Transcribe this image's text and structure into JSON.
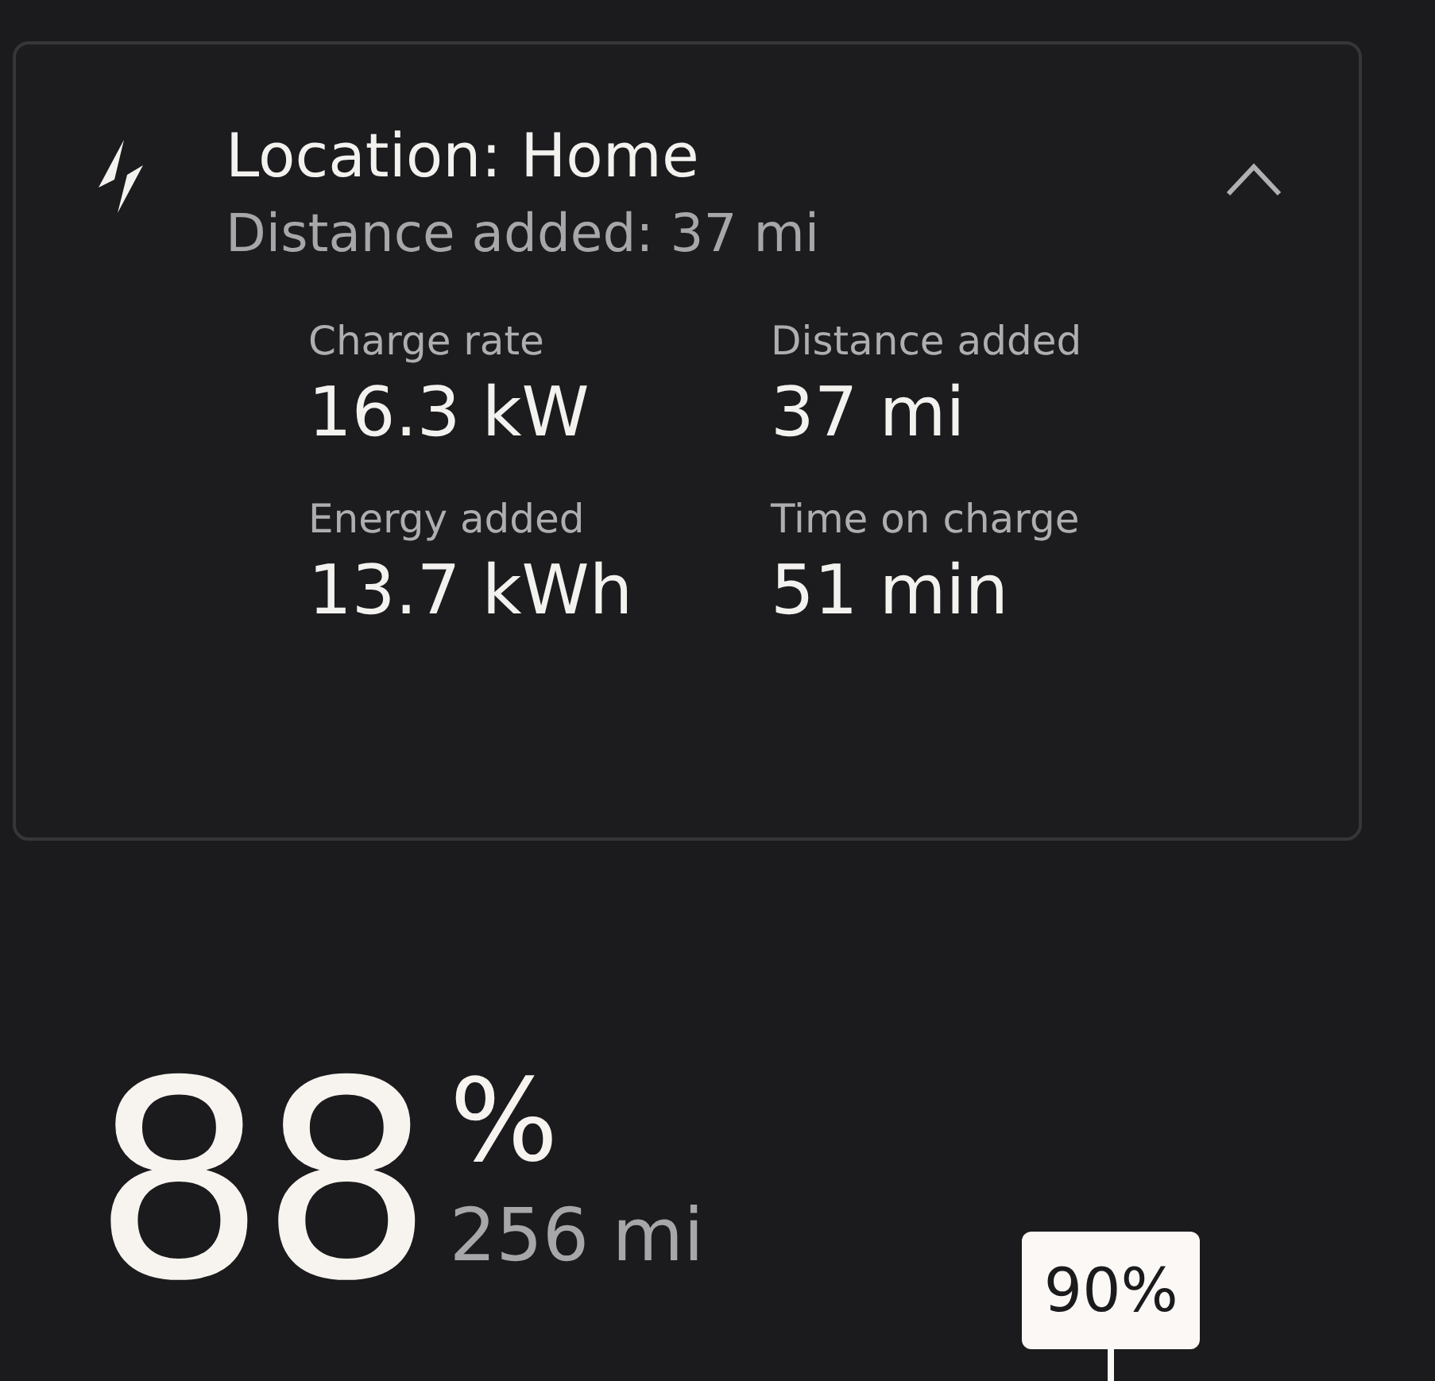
{
  "charge_session": {
    "title": "Location: Home",
    "subtitle": "Distance added: 37 mi",
    "expanded": true,
    "stats": [
      {
        "label": "Charge rate",
        "value": "16.3 kW"
      },
      {
        "label": "Distance added",
        "value": "37 mi"
      },
      {
        "label": "Energy added",
        "value": "13.7 kWh"
      },
      {
        "label": "Time on charge",
        "value": "51 min"
      }
    ]
  },
  "battery": {
    "percent": "88",
    "unit": "%",
    "range": "256 mi"
  },
  "charge_limit": {
    "label": "90%"
  }
}
